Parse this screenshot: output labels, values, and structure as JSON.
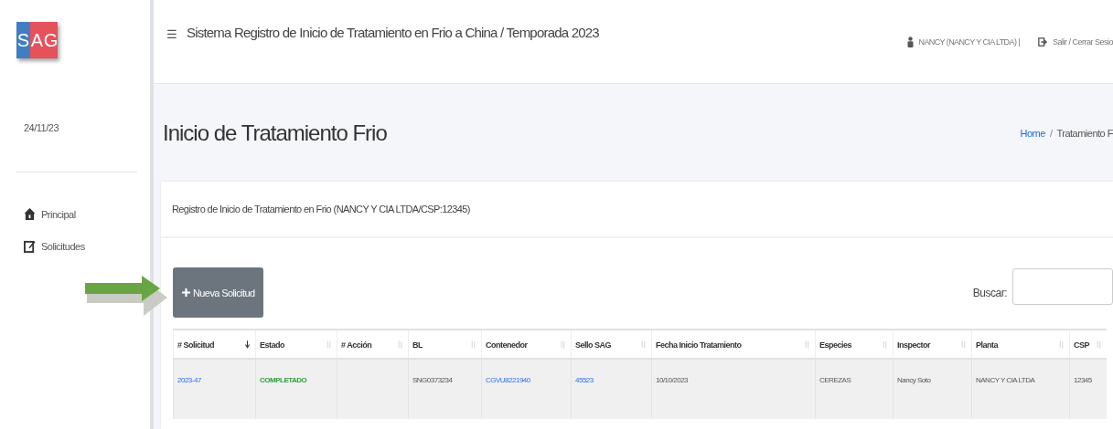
{
  "logo": {
    "letters": [
      "S",
      "A",
      "G"
    ]
  },
  "header": {
    "menu_glyph": "☰",
    "title": "Sistema Registro de Inicio de Tratamiento en Frio a China / Temporada 2023",
    "user": "NANCY (NANCY Y CIA LTDA) |",
    "logout": "Salir / Cerrar Sesio"
  },
  "sidebar": {
    "date": "24/11/23",
    "items": [
      {
        "label": "Principal"
      },
      {
        "label": "Solicitudes"
      }
    ]
  },
  "page": {
    "title": "Inicio de Tratamiento Frio",
    "breadcrumb_separator": "/",
    "breadcrumb": [
      {
        "label": "Home",
        "kind": "link"
      },
      {
        "label": "Tratamiento F",
        "kind": "text"
      }
    ]
  },
  "card": {
    "title": "Registro de Inicio de Tratamiento en Frio (NANCY Y CIA LTDA/CSP:12345)",
    "new_button": "Nueva Solicitud",
    "search_label": "Buscar:"
  },
  "table": {
    "columns": [
      {
        "label": "# Solicitud",
        "sorted": true
      },
      {
        "label": "Estado",
        "sorted": false
      },
      {
        "label": "# Acción",
        "sorted": false
      },
      {
        "label": "BL",
        "sorted": false
      },
      {
        "label": "Contenedor",
        "sorted": false
      },
      {
        "label": "Sello SAG",
        "sorted": false
      },
      {
        "label": "Fecha Inicio Tratamiento",
        "sorted": false
      },
      {
        "label": "Especies",
        "sorted": false
      },
      {
        "label": "Inspector",
        "sorted": false
      },
      {
        "label": "Planta",
        "sorted": false
      },
      {
        "label": "CSP",
        "sorted": false
      }
    ],
    "rows": [
      [
        {
          "text": "2023-47",
          "kind": "link"
        },
        {
          "text": "COMPLETADO",
          "kind": "status"
        },
        {
          "text": "",
          "kind": "text"
        },
        {
          "text": "SNG0373234",
          "kind": "text"
        },
        {
          "text": "CGVU8221940",
          "kind": "link"
        },
        {
          "text": "45523",
          "kind": "link"
        },
        {
          "text": "10/10/2023",
          "kind": "text"
        },
        {
          "text": "CEREZAS",
          "kind": "text"
        },
        {
          "text": "Nancy Soto",
          "kind": "text"
        },
        {
          "text": "NANCY Y CIA LTDA",
          "kind": "text"
        },
        {
          "text": "12345",
          "kind": "text"
        }
      ]
    ]
  }
}
